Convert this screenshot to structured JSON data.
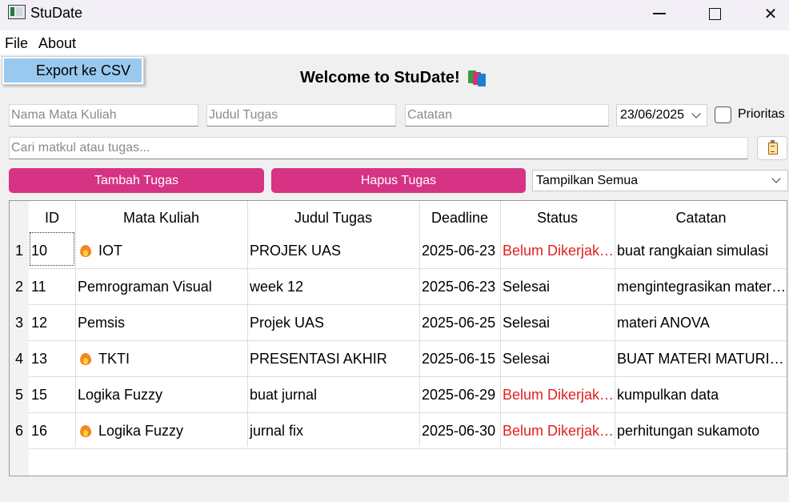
{
  "window": {
    "title": "StuDate"
  },
  "menubar": {
    "file": "File",
    "about": "About"
  },
  "file_menu": {
    "export": "Export ke CSV"
  },
  "header": {
    "welcome": "Welcome to StuDate!"
  },
  "form": {
    "matkul_placeholder": "Nama Mata Kuliah",
    "judul_placeholder": "Judul Tugas",
    "catatan_placeholder": "Catatan",
    "date_value": "23/06/2025",
    "prioritas_label": "Prioritas",
    "prioritas_checked": false,
    "search_placeholder": "Cari matkul atau tugas..."
  },
  "actions": {
    "tambah": "Tambah Tugas",
    "hapus": "Hapus Tugas"
  },
  "filter": {
    "selected": "Tampilkan Semua"
  },
  "colors": {
    "accent_button": "#d63384",
    "status_pending": "#e0211f",
    "menu_highlight": "#99c9ef"
  },
  "table": {
    "columns": [
      "ID",
      "Mata Kuliah",
      "Judul Tugas",
      "Deadline",
      "Status",
      "Catatan"
    ],
    "rows": [
      {
        "num": "1",
        "id": "10",
        "matkul": "IOT",
        "priority": true,
        "judul": "PROJEK UAS",
        "deadline": "2025-06-23",
        "status": "Belum Dikerjakan",
        "catatan": "buat rangkaian simulasi"
      },
      {
        "num": "2",
        "id": "11",
        "matkul": "Pemrograman Visual",
        "priority": false,
        "judul": "week 12",
        "deadline": "2025-06-23",
        "status": "Selesai",
        "catatan": "mengintegrasikan materi…"
      },
      {
        "num": "3",
        "id": "12",
        "matkul": "Pemsis",
        "priority": false,
        "judul": "Projek UAS",
        "deadline": "2025-06-25",
        "status": "Selesai",
        "catatan": "materi ANOVA"
      },
      {
        "num": "4",
        "id": "13",
        "matkul": "TKTI",
        "priority": true,
        "judul": "PRESENTASI AKHIR",
        "deadline": "2025-06-15",
        "status": "Selesai",
        "catatan": "BUAT MATERI MATURITY"
      },
      {
        "num": "5",
        "id": "15",
        "matkul": "Logika Fuzzy",
        "priority": false,
        "judul": "buat jurnal",
        "deadline": "2025-06-29",
        "status": "Belum Dikerjakan",
        "catatan": "kumpulkan data"
      },
      {
        "num": "6",
        "id": "16",
        "matkul": "Logika Fuzzy",
        "priority": true,
        "judul": "jurnal fix",
        "deadline": "2025-06-30",
        "status": "Belum Dikerjakan",
        "catatan": "perhitungan sukamoto"
      }
    ]
  }
}
